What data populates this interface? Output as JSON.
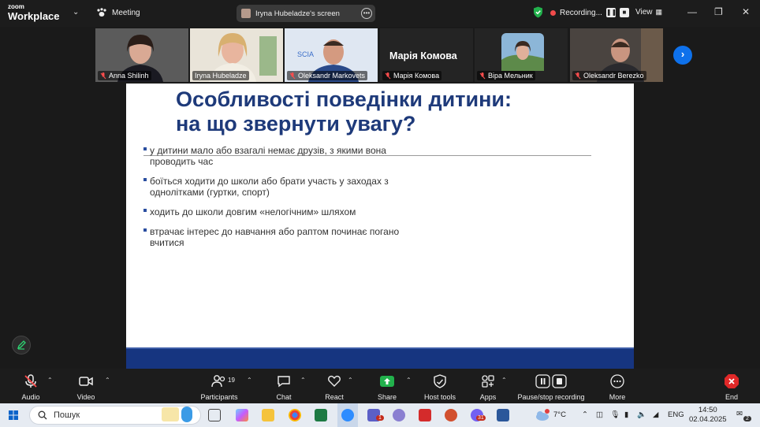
{
  "app": {
    "logo_top": "zoom",
    "logo_bottom": "Workplace",
    "meeting_label": "Meeting"
  },
  "screen_share": {
    "label": "Iryna Hubeladze's screen"
  },
  "recording": {
    "label": "Recording..."
  },
  "view": {
    "label": "View"
  },
  "participants": [
    {
      "name": "Anna Shilinh",
      "mic": "muted"
    },
    {
      "name": "Iryna Hubeladze",
      "mic": "on",
      "active": true
    },
    {
      "name": "Oleksandr Markovets",
      "mic": "muted"
    },
    {
      "name": "Марія Комова",
      "mic": "muted",
      "display_name": "Марія Комова"
    },
    {
      "name": "Віра Мельник",
      "mic": "muted"
    },
    {
      "name": "Oleksandr Berezko",
      "mic": "muted"
    }
  ],
  "slide": {
    "title_line1": "Особливості поведінки дитини:",
    "title_line2": "на що звернути увагу?",
    "bullets": [
      "у дитини мало або взагалі немає друзів, з якими вона проводить час",
      "боїться ходити до школи або брати участь у заходах з однолітками (гуртки, спорт)",
      "ходить до школи довгим «нелогічним» шляхом",
      "втрачає інтерес до навчання або раптом починає погано вчитися"
    ]
  },
  "toolbar": {
    "audio": "Audio",
    "video": "Video",
    "participants": "Participants",
    "participants_count": "19",
    "chat": "Chat",
    "react": "React",
    "share": "Share",
    "host_tools": "Host tools",
    "apps": "Apps",
    "pause_stop": "Pause/stop recording",
    "more": "More",
    "end": "End"
  },
  "taskbar": {
    "search_placeholder": "Пошук",
    "temperature": "7°C",
    "language": "ENG",
    "time": "14:50",
    "date": "02.04.2025",
    "notifications": "2",
    "teams_badge": "1",
    "viber_badge": "31"
  },
  "colors": {
    "accent": "#0e71eb",
    "slide_title": "#1e3a7a",
    "active_speaker": "#2ed573",
    "end": "#e02828"
  }
}
